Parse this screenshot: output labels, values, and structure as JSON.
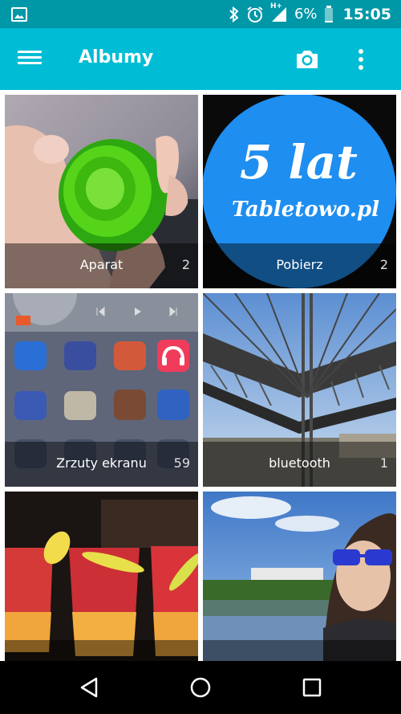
{
  "status_bar": {
    "network": "H+",
    "battery": "6%",
    "time": "15:05"
  },
  "app_bar": {
    "title": "Albumy"
  },
  "albums": [
    {
      "name": "Aparat",
      "count": "2"
    },
    {
      "name": "Pobierz",
      "count": "2",
      "thumbnail_text": [
        "5 lat",
        "Tabletowo.pl"
      ]
    },
    {
      "name": "Zrzuty ekranu",
      "count": "59"
    },
    {
      "name": "bluetooth",
      "count": "1"
    },
    {
      "name": "",
      "count": ""
    },
    {
      "name": "",
      "count": ""
    }
  ],
  "icons": {
    "status": [
      "image-icon",
      "bluetooth-icon",
      "alarm-icon",
      "signal-icon",
      "battery-icon"
    ],
    "app_bar": [
      "menu-icon",
      "camera-icon",
      "more-vert-icon"
    ],
    "nav": [
      "back-icon",
      "home-icon",
      "recents-icon"
    ]
  },
  "colors": {
    "status_bar": "#0097a7",
    "app_bar": "#00bcd4",
    "nav_bar": "#000000"
  }
}
